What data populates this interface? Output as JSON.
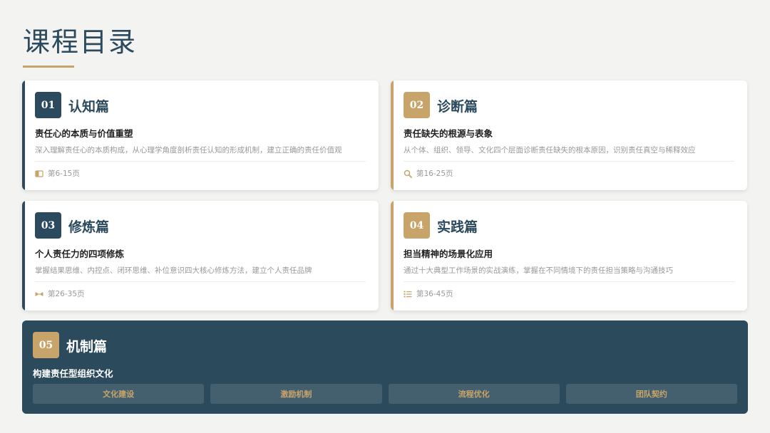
{
  "page": {
    "title": "课程目录"
  },
  "colors": {
    "navy": "#2c4a5e",
    "gold": "#c8a46b",
    "background": "#f3f3f1"
  },
  "modules": [
    {
      "number": "01",
      "title": "认知篇",
      "subtitle": "责任心的本质与价值重塑",
      "description": "深入理解责任心的本质构成，从心理学角度剖析责任认知的形成机制，建立正确的责任价值观",
      "pages": "第6-15页",
      "icon": "book-icon"
    },
    {
      "number": "02",
      "title": "诊断篇",
      "subtitle": "责任缺失的根源与表象",
      "description": "从个体、组织、领导、文化四个层面诊断责任缺失的根本原因，识别责任真空与稀释效应",
      "pages": "第16-25页",
      "icon": "search-icon"
    },
    {
      "number": "03",
      "title": "修炼篇",
      "subtitle": "个人责任力的四项修炼",
      "description": "掌握结果思维、内控点、闭环思维、补位意识四大核心修炼方法，建立个人责任品牌",
      "pages": "第26-35页",
      "icon": "dumbbell-icon"
    },
    {
      "number": "04",
      "title": "实践篇",
      "subtitle": "担当精神的场景化应用",
      "description": "通过十大典型工作场景的实战演练，掌握在不同情境下的责任担当策略与沟通技巧",
      "pages": "第36-45页",
      "icon": "list-icon"
    }
  ],
  "mechanism": {
    "number": "05",
    "title": "机制篇",
    "subtitle": "构建责任型组织文化",
    "tags": [
      "文化建设",
      "激励机制",
      "流程优化",
      "团队契约"
    ]
  }
}
